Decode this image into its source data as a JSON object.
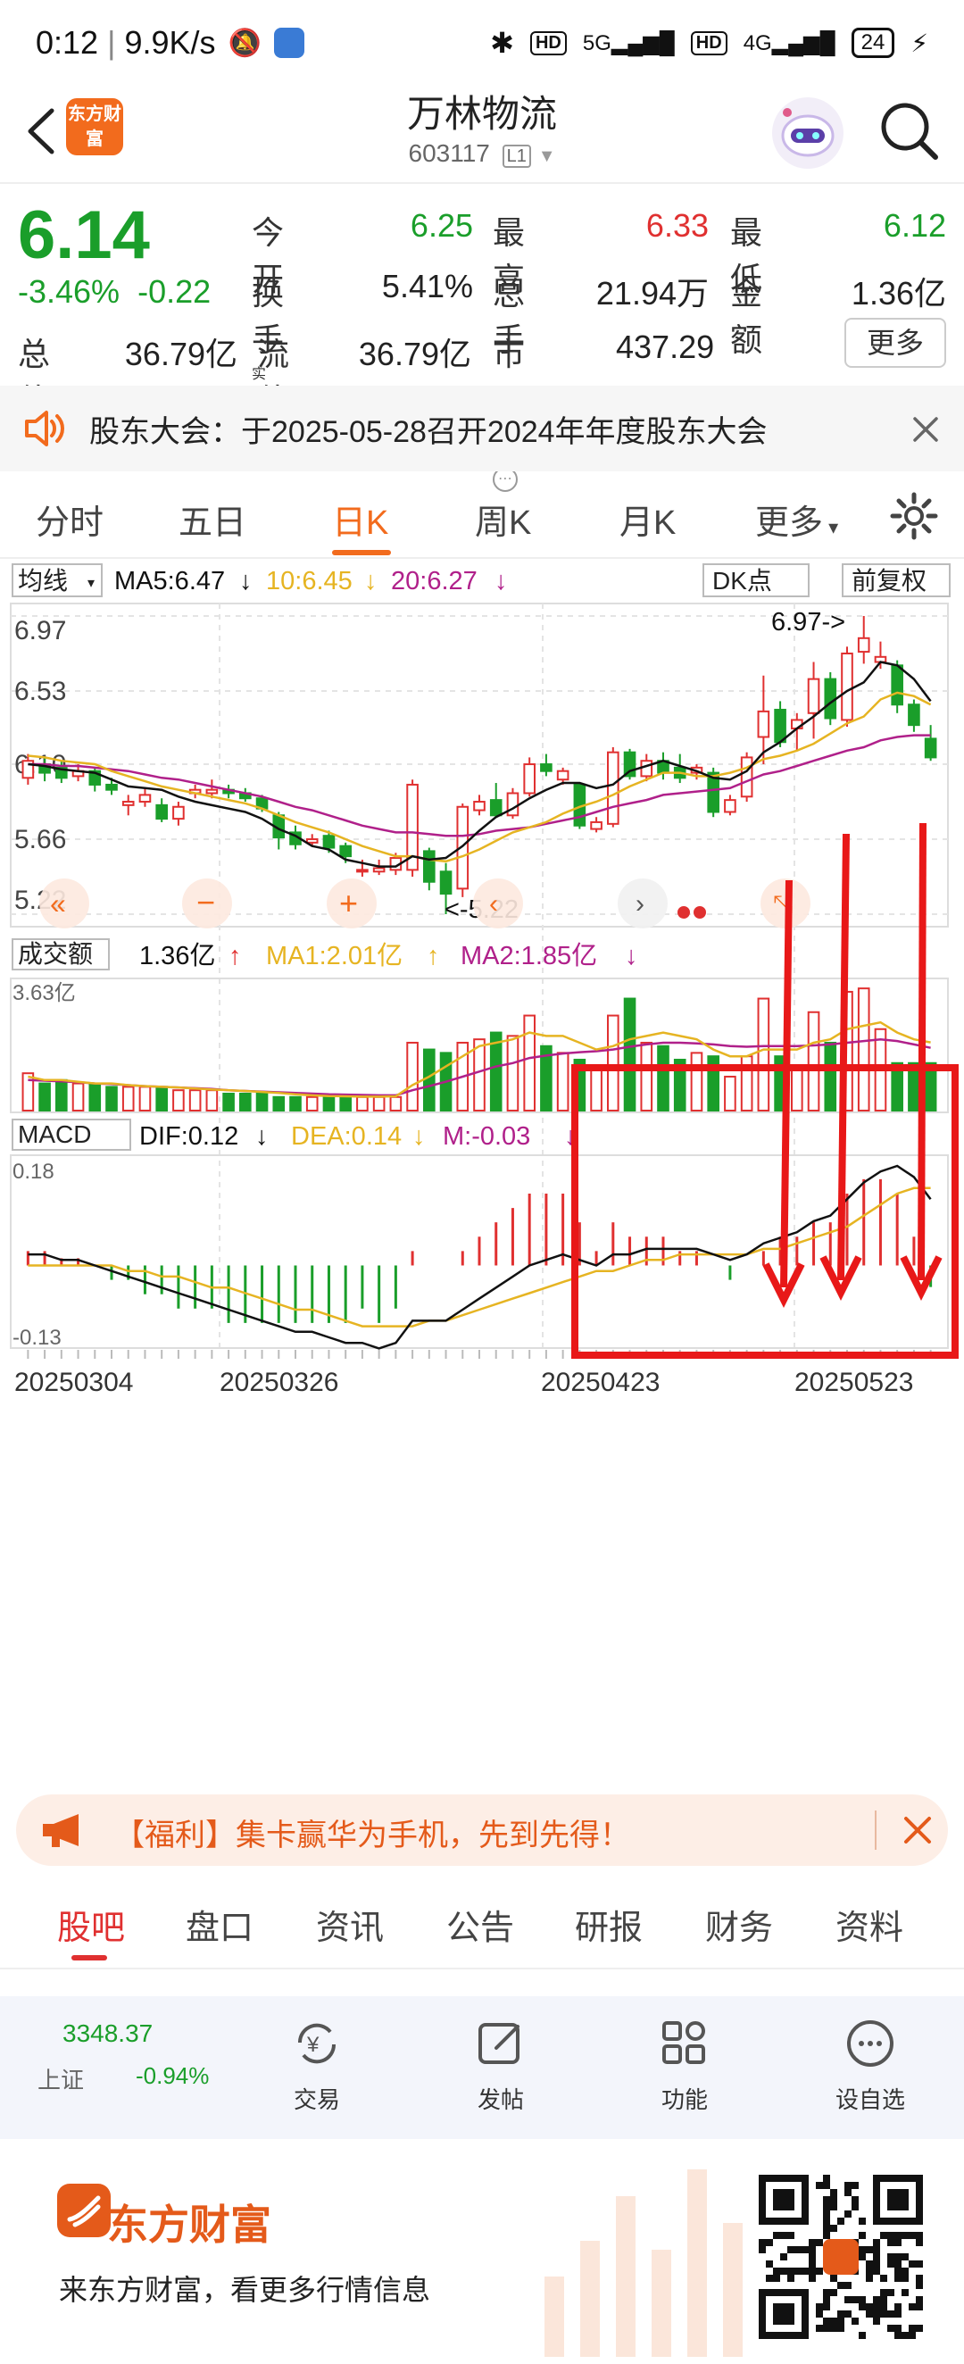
{
  "status": {
    "time": "0:12",
    "speed": "9.9K/s",
    "hd": "HD",
    "sig1": "5G",
    "sig2": "4G",
    "battery": "24"
  },
  "header": {
    "logo_text": "东方财富",
    "title": "万林物流",
    "code": "603117",
    "level": "L1"
  },
  "quote": {
    "price": "6.14",
    "change_pct": "-3.46%",
    "change": "-0.22",
    "open_label": "今开",
    "open": "6.25",
    "high_label": "最高",
    "high": "6.33",
    "low_label": "最低",
    "low": "6.12",
    "turnover_label": "换手",
    "turnover_sup": "实",
    "turnover": "5.41%",
    "volume_label": "总手",
    "volume": "21.94万",
    "amount_label": "金额",
    "amount": "1.36亿",
    "mcap_label": "总值",
    "mcap": "36.79亿",
    "float_label": "流值",
    "float": "36.79亿",
    "pe_label": "市盈",
    "pe_sup": "动",
    "pe": "437.29",
    "more_label": "更多"
  },
  "notice": {
    "text": "股东大会：于2025-05-28召开2024年年度股东大会"
  },
  "tabs": [
    "分时",
    "五日",
    "日K",
    "周K",
    "月K",
    "更多"
  ],
  "chart": {
    "ma_select": "均线",
    "ma5": "MA5:6.47",
    "ma10": "10:6.45",
    "ma20": "20:6.27",
    "dk_label": "DK点",
    "adjust_label": "前复权",
    "price_ticks": [
      "6.97",
      "6.53",
      "6.10",
      "5.66",
      "5.22"
    ],
    "high_marker": "6.97->",
    "low_marker": "<-5.22",
    "vol_title": "成交额",
    "vol_value": "1.36亿",
    "vol_ma1": "MA1:2.01亿",
    "vol_ma2": "MA2:1.85亿",
    "vol_top": "3.63亿",
    "macd_title": "MACD",
    "dif": "DIF:0.12",
    "dea": "DEA:0.14",
    "m": "M:-0.03",
    "macd_top": "0.18",
    "macd_bottom": "-0.13",
    "dates": [
      "20250304",
      "20250326",
      "20250423",
      "20250523"
    ]
  },
  "chart_data": {
    "type": "candlestick",
    "price_range": [
      5.22,
      6.97
    ],
    "candles": [
      {
        "o": 6.02,
        "c": 6.12,
        "h": 6.16,
        "l": 5.98
      },
      {
        "o": 6.1,
        "c": 6.05,
        "h": 6.14,
        "l": 6.0
      },
      {
        "o": 6.08,
        "c": 6.02,
        "h": 6.12,
        "l": 5.99
      },
      {
        "o": 6.03,
        "c": 6.06,
        "h": 6.1,
        "l": 6.0
      },
      {
        "o": 6.06,
        "c": 5.98,
        "h": 6.08,
        "l": 5.94
      },
      {
        "o": 5.98,
        "c": 5.95,
        "h": 6.02,
        "l": 5.92
      },
      {
        "o": 5.86,
        "c": 5.88,
        "h": 5.92,
        "l": 5.8
      },
      {
        "o": 5.88,
        "c": 5.92,
        "h": 5.96,
        "l": 5.85
      },
      {
        "o": 5.86,
        "c": 5.78,
        "h": 5.9,
        "l": 5.76
      },
      {
        "o": 5.78,
        "c": 5.85,
        "h": 5.88,
        "l": 5.74
      },
      {
        "o": 5.93,
        "c": 5.95,
        "h": 5.98,
        "l": 5.9
      },
      {
        "o": 5.93,
        "c": 5.95,
        "h": 6.01,
        "l": 5.9
      },
      {
        "o": 5.95,
        "c": 5.93,
        "h": 5.98,
        "l": 5.9
      },
      {
        "o": 5.93,
        "c": 5.9,
        "h": 5.96,
        "l": 5.88
      },
      {
        "o": 5.9,
        "c": 5.84,
        "h": 5.92,
        "l": 5.82
      },
      {
        "o": 5.8,
        "c": 5.67,
        "h": 5.82,
        "l": 5.6
      },
      {
        "o": 5.7,
        "c": 5.63,
        "h": 5.74,
        "l": 5.6
      },
      {
        "o": 5.64,
        "c": 5.66,
        "h": 5.69,
        "l": 5.62
      },
      {
        "o": 5.68,
        "c": 5.61,
        "h": 5.71,
        "l": 5.58
      },
      {
        "o": 5.62,
        "c": 5.56,
        "h": 5.64,
        "l": 5.52
      },
      {
        "o": 5.47,
        "c": 5.48,
        "h": 5.54,
        "l": 5.44
      },
      {
        "o": 5.47,
        "c": 5.49,
        "h": 5.54,
        "l": 5.45
      },
      {
        "o": 5.48,
        "c": 5.55,
        "h": 5.58,
        "l": 5.45
      },
      {
        "o": 5.48,
        "c": 5.98,
        "h": 6.01,
        "l": 5.44
      },
      {
        "o": 5.59,
        "c": 5.41,
        "h": 5.61,
        "l": 5.36
      },
      {
        "o": 5.47,
        "c": 5.34,
        "h": 5.52,
        "l": 5.22
      },
      {
        "o": 5.37,
        "c": 5.85,
        "h": 5.87,
        "l": 5.32
      },
      {
        "o": 5.83,
        "c": 5.88,
        "h": 5.92,
        "l": 5.8
      },
      {
        "o": 5.89,
        "c": 5.8,
        "h": 5.99,
        "l": 5.79
      },
      {
        "o": 5.8,
        "c": 5.93,
        "h": 5.96,
        "l": 5.78
      },
      {
        "o": 5.93,
        "c": 6.1,
        "h": 6.14,
        "l": 5.91
      },
      {
        "o": 6.1,
        "c": 6.06,
        "h": 6.16,
        "l": 6.03
      },
      {
        "o": 6.01,
        "c": 6.06,
        "h": 6.08,
        "l": 5.98
      },
      {
        "o": 5.98,
        "c": 5.74,
        "h": 5.99,
        "l": 5.72
      },
      {
        "o": 5.72,
        "c": 5.76,
        "h": 5.79,
        "l": 5.7
      },
      {
        "o": 5.75,
        "c": 6.17,
        "h": 6.2,
        "l": 5.73
      },
      {
        "o": 6.17,
        "c": 6.03,
        "h": 6.19,
        "l": 6.01
      },
      {
        "o": 6.03,
        "c": 6.12,
        "h": 6.16,
        "l": 6.0
      },
      {
        "o": 6.12,
        "c": 6.05,
        "h": 6.17,
        "l": 6.01
      },
      {
        "o": 6.08,
        "c": 6.02,
        "h": 6.16,
        "l": 5.99
      },
      {
        "o": 6.05,
        "c": 6.08,
        "h": 6.1,
        "l": 6.01
      },
      {
        "o": 6.05,
        "c": 5.82,
        "h": 6.08,
        "l": 5.79
      },
      {
        "o": 5.82,
        "c": 5.89,
        "h": 5.92,
        "l": 5.8
      },
      {
        "o": 5.91,
        "c": 6.14,
        "h": 6.17,
        "l": 5.88
      },
      {
        "o": 6.26,
        "c": 6.41,
        "h": 6.62,
        "l": 6.1
      },
      {
        "o": 6.42,
        "c": 6.23,
        "h": 6.47,
        "l": 6.2
      },
      {
        "o": 6.31,
        "c": 6.36,
        "h": 6.4,
        "l": 6.18
      },
      {
        "o": 6.4,
        "c": 6.6,
        "h": 6.7,
        "l": 6.25
      },
      {
        "o": 6.6,
        "c": 6.37,
        "h": 6.64,
        "l": 6.33
      },
      {
        "o": 6.36,
        "c": 6.75,
        "h": 6.79,
        "l": 6.32
      },
      {
        "o": 6.76,
        "c": 6.84,
        "h": 6.97,
        "l": 6.69
      },
      {
        "o": 6.7,
        "c": 6.73,
        "h": 6.82,
        "l": 6.66
      },
      {
        "o": 6.68,
        "c": 6.45,
        "h": 6.71,
        "l": 6.4
      },
      {
        "o": 6.45,
        "c": 6.33,
        "h": 6.48,
        "l": 6.29
      },
      {
        "o": 6.25,
        "c": 6.14,
        "h": 6.33,
        "l": 6.12
      }
    ],
    "ma5": [
      6.1,
      6.09,
      6.07,
      6.06,
      6.05,
      6.01,
      5.97,
      5.96,
      5.95,
      5.91,
      5.88,
      5.86,
      5.84,
      5.82,
      5.78,
      5.72,
      5.68,
      5.62,
      5.6,
      5.54,
      5.52,
      5.5,
      5.5,
      5.56,
      5.54,
      5.55,
      5.62,
      5.71,
      5.79,
      5.84,
      5.9,
      5.95,
      5.99,
      5.99,
      5.96,
      5.98,
      6.06,
      6.09,
      6.12,
      6.09,
      6.06,
      6.02,
      6.01,
      6.06,
      6.17,
      6.23,
      6.31,
      6.38,
      6.46,
      6.53,
      6.58,
      6.7,
      6.68,
      6.6,
      6.47
    ],
    "ma10": [
      6.15,
      6.14,
      6.12,
      6.11,
      6.1,
      6.06,
      6.03,
      6.0,
      5.97,
      5.95,
      5.93,
      5.91,
      5.89,
      5.87,
      5.84,
      5.8,
      5.76,
      5.73,
      5.7,
      5.66,
      5.62,
      5.59,
      5.56,
      5.56,
      5.54,
      5.53,
      5.56,
      5.6,
      5.65,
      5.7,
      5.73,
      5.76,
      5.81,
      5.85,
      5.88,
      5.92,
      5.97,
      6.01,
      6.05,
      6.05,
      6.03,
      6.03,
      6.05,
      6.08,
      6.13,
      6.15,
      6.18,
      6.22,
      6.28,
      6.34,
      6.38,
      6.48,
      6.52,
      6.5,
      6.45
    ],
    "ma20": [
      6.1,
      6.1,
      6.09,
      6.09,
      6.08,
      6.07,
      6.06,
      6.04,
      6.02,
      6.01,
      5.99,
      5.97,
      5.95,
      5.93,
      5.91,
      5.88,
      5.85,
      5.83,
      5.8,
      5.77,
      5.74,
      5.72,
      5.7,
      5.7,
      5.69,
      5.68,
      5.68,
      5.69,
      5.71,
      5.72,
      5.73,
      5.75,
      5.77,
      5.79,
      5.82,
      5.85,
      5.87,
      5.89,
      5.92,
      5.93,
      5.94,
      5.95,
      5.96,
      6.0,
      6.04,
      6.06,
      6.09,
      6.12,
      6.15,
      6.18,
      6.2,
      6.24,
      6.26,
      6.27,
      6.27
    ],
    "volume_range": [
      0,
      3.63
    ],
    "volume": [
      1.1,
      0.8,
      0.9,
      0.8,
      0.8,
      0.7,
      0.7,
      0.7,
      0.7,
      0.6,
      0.6,
      0.6,
      0.5,
      0.5,
      0.5,
      0.4,
      0.4,
      0.4,
      0.4,
      0.4,
      0.4,
      0.4,
      0.4,
      2.0,
      1.8,
      1.7,
      2.0,
      2.1,
      2.3,
      2.2,
      2.8,
      1.9,
      1.7,
      1.5,
      1.2,
      2.8,
      3.3,
      2.0,
      1.9,
      1.5,
      1.7,
      1.6,
      1.0,
      1.6,
      3.3,
      1.6,
      1.2,
      2.9,
      2.0,
      3.5,
      3.6,
      2.4,
      1.4,
      1.4,
      1.4
    ],
    "vol_ma1": [
      1.0,
      0.9,
      0.9,
      0.85,
      0.8,
      0.8,
      0.75,
      0.72,
      0.7,
      0.68,
      0.65,
      0.62,
      0.6,
      0.58,
      0.55,
      0.52,
      0.48,
      0.45,
      0.43,
      0.42,
      0.41,
      0.41,
      0.42,
      0.75,
      1.0,
      1.3,
      1.6,
      1.9,
      2.0,
      2.1,
      2.3,
      2.2,
      2.2,
      2.0,
      1.8,
      1.9,
      2.1,
      2.2,
      2.3,
      2.2,
      2.1,
      1.8,
      1.6,
      1.6,
      1.8,
      1.8,
      1.8,
      2.0,
      2.1,
      2.4,
      2.5,
      2.6,
      2.3,
      2.1,
      2.01
    ],
    "vol_ma2": [
      0.9,
      0.88,
      0.86,
      0.84,
      0.8,
      0.78,
      0.75,
      0.72,
      0.7,
      0.68,
      0.66,
      0.64,
      0.6,
      0.58,
      0.56,
      0.54,
      0.52,
      0.5,
      0.48,
      0.47,
      0.46,
      0.45,
      0.45,
      0.6,
      0.72,
      0.85,
      1.0,
      1.15,
      1.3,
      1.4,
      1.55,
      1.62,
      1.68,
      1.72,
      1.75,
      1.8,
      1.88,
      1.95,
      2.0,
      2.0,
      1.98,
      1.95,
      1.9,
      1.88,
      1.9,
      1.9,
      1.9,
      1.92,
      1.95,
      2.0,
      2.05,
      2.1,
      2.05,
      1.95,
      1.85
    ],
    "macd_range": [
      -0.13,
      0.18
    ],
    "dif": [
      0.02,
      0.02,
      0.01,
      0.01,
      0.0,
      -0.01,
      -0.02,
      -0.03,
      -0.04,
      -0.05,
      -0.06,
      -0.07,
      -0.08,
      -0.09,
      -0.1,
      -0.11,
      -0.12,
      -0.12,
      -0.13,
      -0.14,
      -0.14,
      -0.15,
      -0.14,
      -0.1,
      -0.1,
      -0.1,
      -0.08,
      -0.06,
      -0.04,
      -0.02,
      0.0,
      0.01,
      0.02,
      0.01,
      0.0,
      0.02,
      0.02,
      0.03,
      0.03,
      0.03,
      0.03,
      0.02,
      0.01,
      0.02,
      0.04,
      0.05,
      0.06,
      0.08,
      0.09,
      0.12,
      0.15,
      0.17,
      0.18,
      0.16,
      0.12
    ],
    "dea": [
      0.0,
      0.0,
      0.0,
      0.0,
      0.0,
      0.0,
      -0.01,
      -0.01,
      -0.02,
      -0.02,
      -0.03,
      -0.04,
      -0.04,
      -0.05,
      -0.06,
      -0.07,
      -0.08,
      -0.08,
      -0.09,
      -0.1,
      -0.11,
      -0.11,
      -0.11,
      -0.11,
      -0.1,
      -0.1,
      -0.09,
      -0.08,
      -0.07,
      -0.06,
      -0.05,
      -0.04,
      -0.03,
      -0.02,
      -0.01,
      -0.01,
      0.0,
      0.01,
      0.01,
      0.02,
      0.02,
      0.02,
      0.02,
      0.02,
      0.03,
      0.03,
      0.04,
      0.05,
      0.06,
      0.07,
      0.09,
      0.11,
      0.13,
      0.14,
      0.14
    ],
    "macd_hist": [
      0.02,
      0.02,
      0.01,
      0.01,
      0.0,
      -0.02,
      -0.02,
      -0.04,
      -0.04,
      -0.06,
      -0.06,
      -0.06,
      -0.08,
      -0.08,
      -0.08,
      -0.08,
      -0.08,
      -0.08,
      -0.08,
      -0.08,
      -0.06,
      -0.08,
      -0.06,
      0.02,
      0.0,
      0.0,
      0.02,
      0.04,
      0.06,
      0.08,
      0.1,
      0.1,
      0.1,
      0.06,
      0.02,
      0.06,
      0.04,
      0.04,
      0.04,
      0.02,
      0.02,
      0.0,
      -0.02,
      0.0,
      0.02,
      0.04,
      0.04,
      0.06,
      0.06,
      0.1,
      0.12,
      0.12,
      0.1,
      0.04,
      -0.03
    ]
  },
  "promo": {
    "text": "【福利】集卡赢华为手机，先到先得！"
  },
  "bottom_tabs": [
    "股吧",
    "盘口",
    "资讯",
    "公告",
    "研报",
    "财务",
    "资料"
  ],
  "toolbar": {
    "index_value": "3348.37",
    "index_label": "上证",
    "index_change": "-0.94%",
    "items": [
      "交易",
      "发帖",
      "功能",
      "设自选"
    ]
  },
  "footer": {
    "brand": "东方财富",
    "tagline": "来东方财富，看更多行情信息"
  },
  "colors": {
    "up": "#e03030",
    "down": "#1a9e2a",
    "accent": "#f26b1d",
    "ma5": "#111111",
    "ma10": "#e6b422",
    "ma20": "#b0208a"
  }
}
